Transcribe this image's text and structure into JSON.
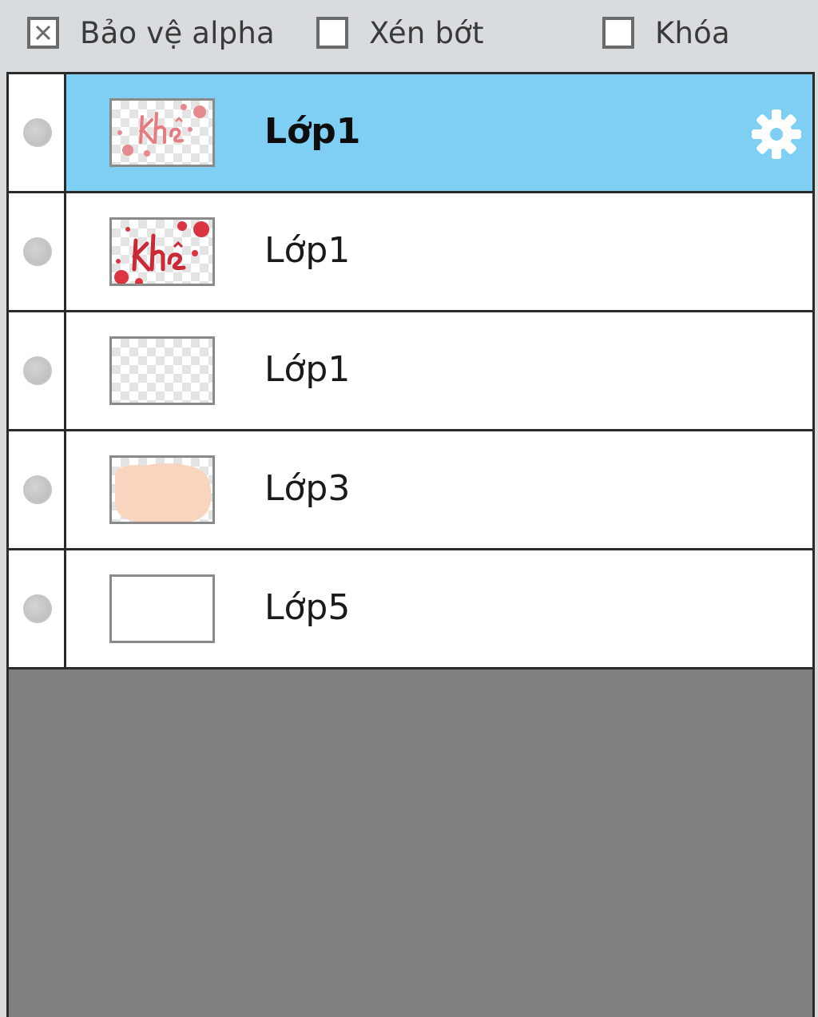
{
  "options": {
    "alpha_protect": {
      "label": "Bảo vệ alpha",
      "checked": true
    },
    "clip": {
      "label": "Xén bớt",
      "checked": false
    },
    "lock": {
      "label": "Khóa",
      "checked": false
    }
  },
  "layers": [
    {
      "name": "Lớp1",
      "selected": true,
      "visible": false,
      "thumb": "khe-light-icon"
    },
    {
      "name": "Lớp1",
      "selected": false,
      "visible": false,
      "thumb": "khe-dark-icon"
    },
    {
      "name": "Lớp1",
      "selected": false,
      "visible": false,
      "thumb": "transparent"
    },
    {
      "name": "Lớp3",
      "selected": false,
      "visible": false,
      "thumb": "skin-blob"
    },
    {
      "name": "Lớp5",
      "selected": false,
      "visible": false,
      "thumb": "blank-white"
    }
  ],
  "colors": {
    "selection": "#7ecff3",
    "thumb_red": "#d9343f",
    "thumb_skin": "#f9d4bf",
    "empty_area": "#808080"
  },
  "icons": {
    "settings": "gear-icon",
    "visibility": "visibility-dot-icon",
    "checkbox_checked": "x-mark-icon"
  }
}
